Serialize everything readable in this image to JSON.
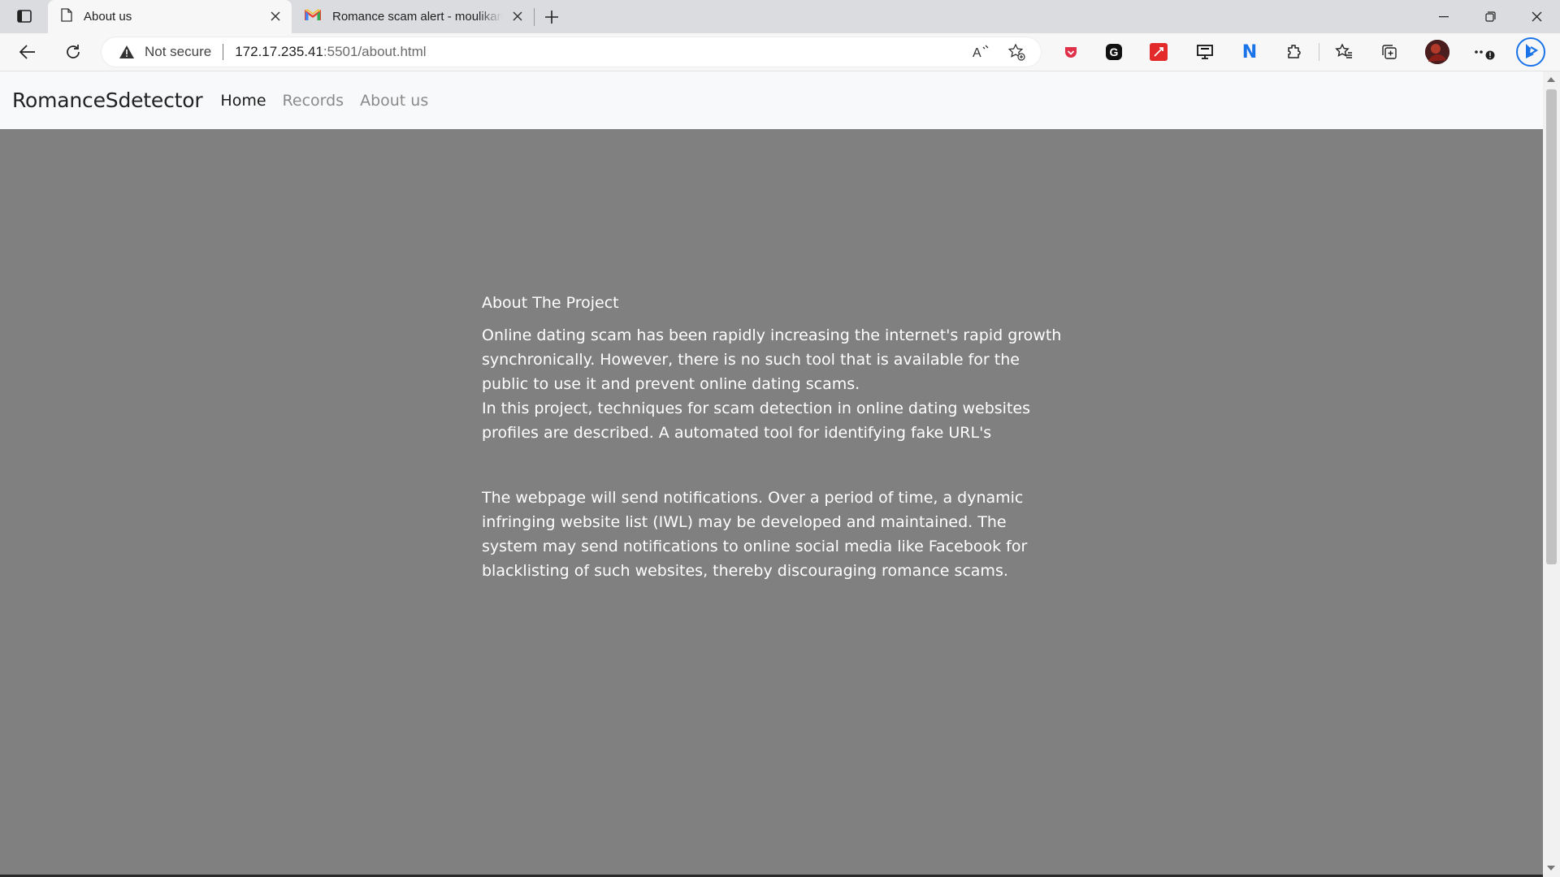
{
  "browser": {
    "tabs": [
      {
        "title": "About us",
        "active": true,
        "icon": "page-icon"
      },
      {
        "title": "Romance scam alert - moulikaroy",
        "active": false,
        "icon": "gmail-icon"
      }
    ],
    "address": {
      "security_label": "Not secure",
      "host": "172.17.235.41",
      "path": ":5501/about.html"
    },
    "colors": {
      "gmail_red": "#ea4335",
      "edge_blue": "#1a73e8",
      "pdf_red": "#e22a2a"
    }
  },
  "navbar": {
    "brand": "RomanceSdetector",
    "links": [
      {
        "label": "Home",
        "active": true
      },
      {
        "label": "Records",
        "active": false
      },
      {
        "label": "About us",
        "active": false
      }
    ]
  },
  "content": {
    "heading": "About The Project",
    "paragraph1_line1": "Online dating scam has been rapidly increasing the internet's rapid growth synchronically. However, there is no such tool that is available for the public to use it and prevent online dating scams.",
    "paragraph1_line2": "In this project, techniques for scam detection in online dating websites profiles are described. A automated tool for identifying fake URL's",
    "paragraph2": "The webpage will send notifications. Over a period of time, a dynamic infringing website list (IWL) may be developed and maintained. The system may send notifications to online social media like Facebook for blacklisting of such websites, thereby discouraging romance scams."
  },
  "page_colors": {
    "background": "#808080",
    "navbar": "#f8f9fa",
    "text": "#ffffff"
  }
}
